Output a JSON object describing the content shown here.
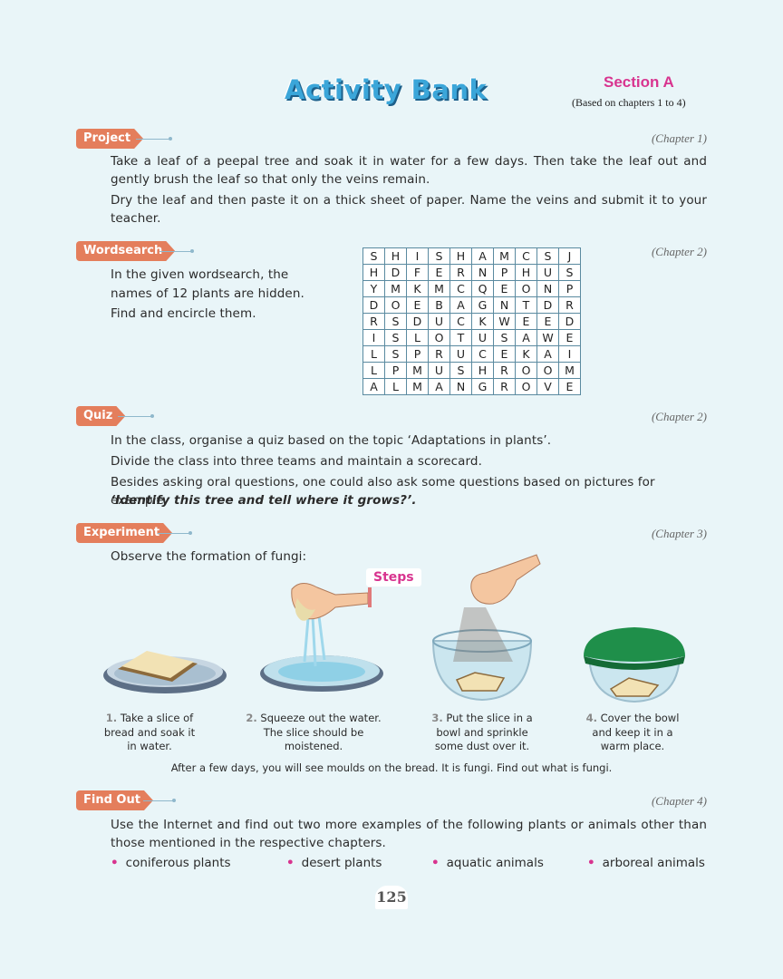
{
  "header": {
    "title": "Activity Bank",
    "section": "Section A",
    "section_sub": "(Based on chapters 1 to 4)"
  },
  "project": {
    "tag": "Project",
    "chapter": "(Chapter 1)",
    "para1": "Take a leaf of a peepal tree and soak it in water for a few days. Then take the leaf out and gently brush the leaf so that only the veins remain.",
    "para2": "Dry the leaf and then paste it on a thick sheet of paper. Name the veins and submit it to your teacher."
  },
  "wordsearch": {
    "tag": "Wordsearch",
    "chapter": "(Chapter 2)",
    "line1": "In the given wordsearch, the",
    "line2": "names of 12 plants are hidden.",
    "line3": "Find and encircle them.",
    "grid": [
      [
        "S",
        "H",
        "I",
        "S",
        "H",
        "A",
        "M",
        "C",
        "S",
        "J"
      ],
      [
        "H",
        "D",
        "F",
        "E",
        "R",
        "N",
        "P",
        "H",
        "U",
        "S"
      ],
      [
        "Y",
        "M",
        "K",
        "M",
        "C",
        "Q",
        "E",
        "O",
        "N",
        "P"
      ],
      [
        "D",
        "O",
        "E",
        "B",
        "A",
        "G",
        "N",
        "T",
        "D",
        "R"
      ],
      [
        "R",
        "S",
        "D",
        "U",
        "C",
        "K",
        "W",
        "E",
        "E",
        "D"
      ],
      [
        "I",
        "S",
        "L",
        "O",
        "T",
        "U",
        "S",
        "A",
        "W",
        "E"
      ],
      [
        "L",
        "S",
        "P",
        "R",
        "U",
        "C",
        "E",
        "K",
        "A",
        "I"
      ],
      [
        "L",
        "P",
        "M",
        "U",
        "S",
        "H",
        "R",
        "O",
        "O",
        "M"
      ],
      [
        "A",
        "L",
        "M",
        "A",
        "N",
        "G",
        "R",
        "O",
        "V",
        "E"
      ]
    ]
  },
  "quiz": {
    "tag": "Quiz",
    "chapter": "(Chapter 2)",
    "line1": "In the class, organise a quiz based on the topic ‘Adaptations in plants’.",
    "line2": "Divide the class into three teams and maintain a scorecard.",
    "line3": "Besides asking oral questions, one could also ask some questions based on pictures for example,",
    "line4": "‘Identify this tree and tell where it grows?’."
  },
  "experiment": {
    "tag": "Experiment",
    "chapter": "(Chapter 3)",
    "intro": "Observe the formation of fungi:",
    "steps_label": "Steps",
    "steps": [
      {
        "num": "1.",
        "l1": "Take a slice of",
        "l2": "bread and soak it",
        "l3": "in water."
      },
      {
        "num": "2.",
        "l1": "Squeeze out the water.",
        "l2": "The slice should be",
        "l3": "moistened."
      },
      {
        "num": "3.",
        "l1": "Put the slice in a",
        "l2": "bowl and sprinkle",
        "l3": "some dust over it."
      },
      {
        "num": "4.",
        "l1": "Cover the bowl",
        "l2": "and keep it in a",
        "l3": "warm place."
      }
    ],
    "conclusion": "After a few days, you will see moulds on the bread. It is fungi. Find out what is fungi."
  },
  "findout": {
    "tag": "Find Out",
    "chapter": "(Chapter 4)",
    "para": "Use the Internet and find out two more examples of the following plants or animals other than those mentioned in the respective chapters.",
    "bullets": [
      "coniferous plants",
      "desert plants",
      "aquatic animals",
      "arboreal animals"
    ]
  },
  "page_number": "125",
  "colors": {
    "background": "#e9f5f8",
    "tag": "#e47e5c",
    "title": "#3ba6d9",
    "accent": "#d8348f"
  }
}
